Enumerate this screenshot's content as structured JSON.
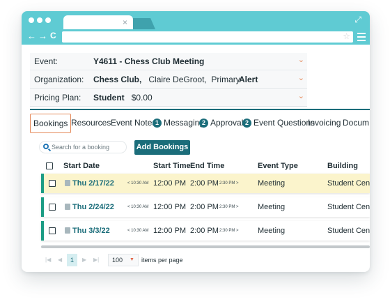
{
  "browser": {
    "tab_close": "×",
    "nav_back": "←",
    "nav_forward": "→",
    "reload": "C",
    "star": "☆",
    "expand": "⤢"
  },
  "event": {
    "event_label": "Event:",
    "event_value": "Y4611 - Chess Club Meeting",
    "org_label": "Organization:",
    "org_name": "Chess Club,",
    "org_contact": "Claire DeGroot,",
    "org_role": "Primary",
    "alert": "Alert",
    "pricing_label": "Pricing Plan:",
    "pricing_plan": "Student",
    "pricing_amount": "$0.00",
    "chevron": "⌄"
  },
  "tabs": [
    {
      "label": "Bookings"
    },
    {
      "label": "Resources"
    },
    {
      "label": "Event Notes"
    },
    {
      "label": "Messaging",
      "badge": "1"
    },
    {
      "label": "Approvals",
      "badge": "2"
    },
    {
      "label": "Event Questions",
      "badge": "2"
    },
    {
      "label": "Invoicing"
    },
    {
      "label": "Docum"
    }
  ],
  "toolbar": {
    "search_placeholder": "Search for a booking",
    "add_label": "Add Bookings"
  },
  "table": {
    "headers": [
      "Start Date",
      "Start Time",
      "End Time",
      "Event Type",
      "Building"
    ],
    "rows": [
      {
        "date": "Thu 2/17/22",
        "setup": "< 10:30 AM",
        "start": "12:00 PM",
        "end": "2:00 PM",
        "teardown": "2:30 PM >",
        "type": "Meeting",
        "building": "Student Cent"
      },
      {
        "date": "Thu 2/24/22",
        "setup": "< 10:30 AM",
        "start": "12:00 PM",
        "end": "2:00 PM",
        "teardown": "2:30 PM >",
        "type": "Meeting",
        "building": "Student Cent"
      },
      {
        "date": "Thu 3/3/22",
        "setup": "< 10:30 AM",
        "start": "12:00 PM",
        "end": "2:00 PM",
        "teardown": "2:30 PM >",
        "type": "Meeting",
        "building": "Student Cent"
      }
    ]
  },
  "pager": {
    "first": "|◀",
    "prev": "◀",
    "current_page": "1",
    "next": "▶",
    "last": "▶|",
    "page_size": "100",
    "size_caret": "▼",
    "items_label": "items per page"
  },
  "colors": {
    "chrome": "#5fcbd3",
    "primary": "#1b6d7a",
    "row_accent": "#1b9c84",
    "highlight": "#fbf4cc",
    "tab_outline": "#e58a5a"
  }
}
